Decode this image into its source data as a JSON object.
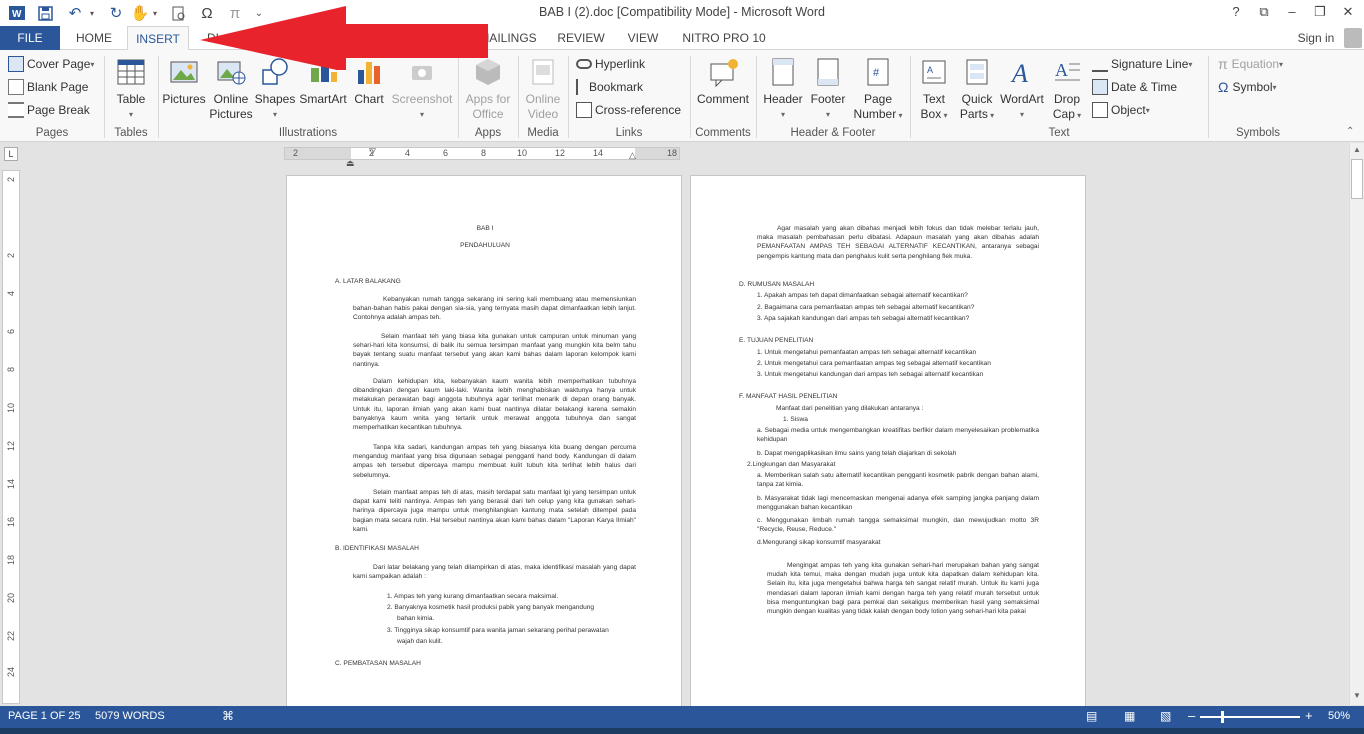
{
  "window": {
    "title": "BAB I (2).doc [Compatibility Mode] - Microsoft Word",
    "help": "?",
    "signin": "Sign in"
  },
  "tabs": [
    "FILE",
    "HOME",
    "INSERT",
    "DI",
    "MAILINGS",
    "REVIEW",
    "VIEW",
    "NITRO PRO 10"
  ],
  "ribbon": {
    "pages": {
      "label": "Pages",
      "cover": "Cover Page",
      "blank": "Blank Page",
      "break": "Page Break"
    },
    "tables": {
      "label": "Tables",
      "table": "Table"
    },
    "illustrations": {
      "label": "Illustrations",
      "pictures": "Pictures",
      "online1": "Online",
      "online2": "Pictures",
      "shapes": "Shapes",
      "smartart": "SmartArt",
      "chart": "Chart",
      "screenshot": "Screenshot"
    },
    "apps": {
      "label": "Apps",
      "a1": "Apps for",
      "a2": "Office"
    },
    "media": {
      "label": "Media",
      "m1": "Online",
      "m2": "Video"
    },
    "links": {
      "label": "Links",
      "hyperlink": "Hyperlink",
      "bookmark": "Bookmark",
      "crossref": "Cross-reference"
    },
    "comments": {
      "label": "Comments",
      "comment": "Comment"
    },
    "hf": {
      "label": "Header & Footer",
      "header": "Header",
      "footer": "Footer",
      "pn1": "Page",
      "pn2": "Number"
    },
    "text": {
      "label": "Text",
      "tb1": "Text",
      "tb2": "Box",
      "qp1": "Quick",
      "qp2": "Parts",
      "wordart": "WordArt",
      "dc1": "Drop",
      "dc2": "Cap",
      "sig": "Signature Line",
      "date": "Date & Time",
      "object": "Object"
    },
    "symbols": {
      "label": "Symbols",
      "equation": "Equation",
      "symbol": "Symbol"
    }
  },
  "ruler": {
    "corner": "L",
    "h": [
      "2",
      "2",
      "4",
      "6",
      "8",
      "10",
      "12",
      "14",
      "18"
    ],
    "v": [
      "2",
      "2",
      "4",
      "6",
      "8",
      "10",
      "12",
      "14",
      "16",
      "18",
      "20",
      "22",
      "24"
    ]
  },
  "page1": {
    "title": "BAB I",
    "subtitle": "PENDAHULUAN",
    "a_head": "A. LATAR BALAKANG",
    "p1": "Kebanyakan rumah tangga sekarang ini sering kali membuang atau memensiunkan bahan-bahan habis pakai dengan sia-sia, yang ternyata masih dapat dimanfaatkan lebih lanjut. Contohnya adalah ampas teh.",
    "p2": "Selain manfaat teh yang biasa kita gunakan untuk campuran untuk minuman yang sehari-hari kita konsumsi, di balik itu semua tersimpan manfaat yang mungkin kita belm tahu bayak tentang suatu manfaat tersebut yang akan kami bahas dalam laporan kelompok kami nantinya.",
    "p3": "Dalam kehidupan kita, kebanyakan kaum wanita lebih memperhatikan tubuhnya dibandingkan dengan kaum laki-laki. Wanita lebih menghabiskan waktunya hanya untuk melakukan perawatan bagi anggota tubuhnya agar terlihat menarik di depan orang banyak. Untuk itu, laporan ilmiah yang akan kami buat nantinya dilatar belakangi karena semakin banyaknya kaum wnita yang tertarik untuk merawat anggota tubuhnya dan sangat memperhatikan kecantikan tubuhnya.",
    "p4": "Tanpa kita sadari, kandungan ampas teh yang biasanya kita buang dengan percuma mengandug manfaat yang bisa digunaan sebagai pengganti hand body. Kandungan di dalam ampas teh tersebut dipercaya mampu membuat kulit tubuh kita terlihat lebih halus dari sebelumnya.",
    "p5": "Selain manfaat ampas teh di atas, masih terdapat satu manfaat lgi yang tersimpan untuk dapat kami teliti nantinya. Ampas teh yang berasal dari teh celup yang kita gunakan sehari-harinya dipercaya juga mampu untuk menghilangkan kantung mata setelah ditempel pada bagian mata secara rutin. Hal tersebut nantinya akan kami bahas dalam \"Laporan Karya Ilmiah\" kami.",
    "b_head": "B. IDENTIFIKASI MASALAH",
    "p6": "Dari latar belakang yang telah dilampirkan di atas, maka identifikasi masalah yang dapat kami sampaikan adalah :",
    "l1": "1.  Ampas teh yang kurang dimanfaatkan secara maksimal.",
    "l2": "2.  Banyaknya kosmetik hasil produksi pabik yang banyak mengandung",
    "l2b": "bahan kimia.",
    "l3": "3.  Tingginya sikap konsumtif para wanita jaman sekarang perihal perawatan",
    "l3b": "wajah dan kulit.",
    "c_head": "C. PEMBATASAN MASALAH"
  },
  "page2": {
    "p1": "Agar masalah yang akan dibahas menjadi lebih fokus dan tidak melebar terlalu jauh, maka masalah pembahasan perlu dibatasi. Adapaun masalah yang akan dibahas adalah PEMANFAATAN AMPAS TEH SEBAGAI ALTERNATIF KECANTIKAN, antaranya sebagai pengempis kantung mata dan penghalus kulit serta penghilang flek muka.",
    "d_head": "D. RUMUSAN MASALAH",
    "d1": "1. Apakah ampas teh dapat dimanfaatkan sebagai alternatif kecantikan?",
    "d2": "2. Bagaimana cara pemanfaatan ampas teh sebagai alternatif kecantikan?",
    "d3": "3. Apa sajakah kandungan dari ampas teh sebagai alternatif kecantikan?",
    "e_head": "E. TUJUAN PENELITIAN",
    "e1": "1. Untuk mengetahui pemanfaatan ampas teh sebagai alternatif kecantikan",
    "e2": "2. Untuk mengetahui cara pemanfaatan ampas teg sebagai alternatif kecantikan",
    "e3": "3. Untuk mengetahui kandungan dari ampas teh sebagai alternatif kecantikan",
    "f_head": "F. MANFAAT HASIL PENELITIAN",
    "f_intro": "Manfaat dari penelitian yang dilakukan antaranya :",
    "f_s1": "1. Siswa",
    "f_a": "a. Sebagai media untuk mengembangkan kreatifitas berfikir dalam menyelesaikan problematika kehidupan",
    "f_b": "b. Dapat mengaplikasikan ilmu sains yang telah diajarkan di sekolah",
    "f_s2": "2.Lingkungan dan Masyarakat",
    "f_a2": "a. Memberikan salah satu alternatif kecantikan pengganti kosmetik pabrik dengan bahan alami, tanpa zat kimia.",
    "f_b2": "b. Masyarakat tidak lagi mencemaskan mengenai adanya efek samping jangka panjang dalam menggunakan bahan kecantikan",
    "f_c2": "c. Menggunakan limbah rumah tangga semaksimal mungkin, dan mewujudkan motto 3R \"Recycle, Reuse, Reduce.\"",
    "f_d2": "d.Mengurangi sikap konsumtif masyarakat",
    "p_last": "Mengingat ampas teh yang kita gunakan sehari-hari merupakan bahan yang sangat mudah kita temui, maka dengan mudah juga untuk kita dapatkan dalam kehidupan kita. Selain itu, kita juga mengetahui bahwa harga teh sangat relatif murah. Untuk itu kami juga mendasari dalam laporan ilmiah kami dengan harga teh yang relatif murah tersebut untuk bisa menguntungkan bagi para pemkai dan sekaligus memberikan hasil yang semaksimal mungkin dengan kualitas yang tidak kalah dengan body lotion yang sehari-hari kita pakai"
  },
  "status": {
    "page": "PAGE 1 OF 25",
    "words": "5079 WORDS",
    "zoom": "50%",
    "zoom_level": 0.5
  },
  "colors": {
    "accent": "#2b579a",
    "arrow": "#e8232b"
  }
}
